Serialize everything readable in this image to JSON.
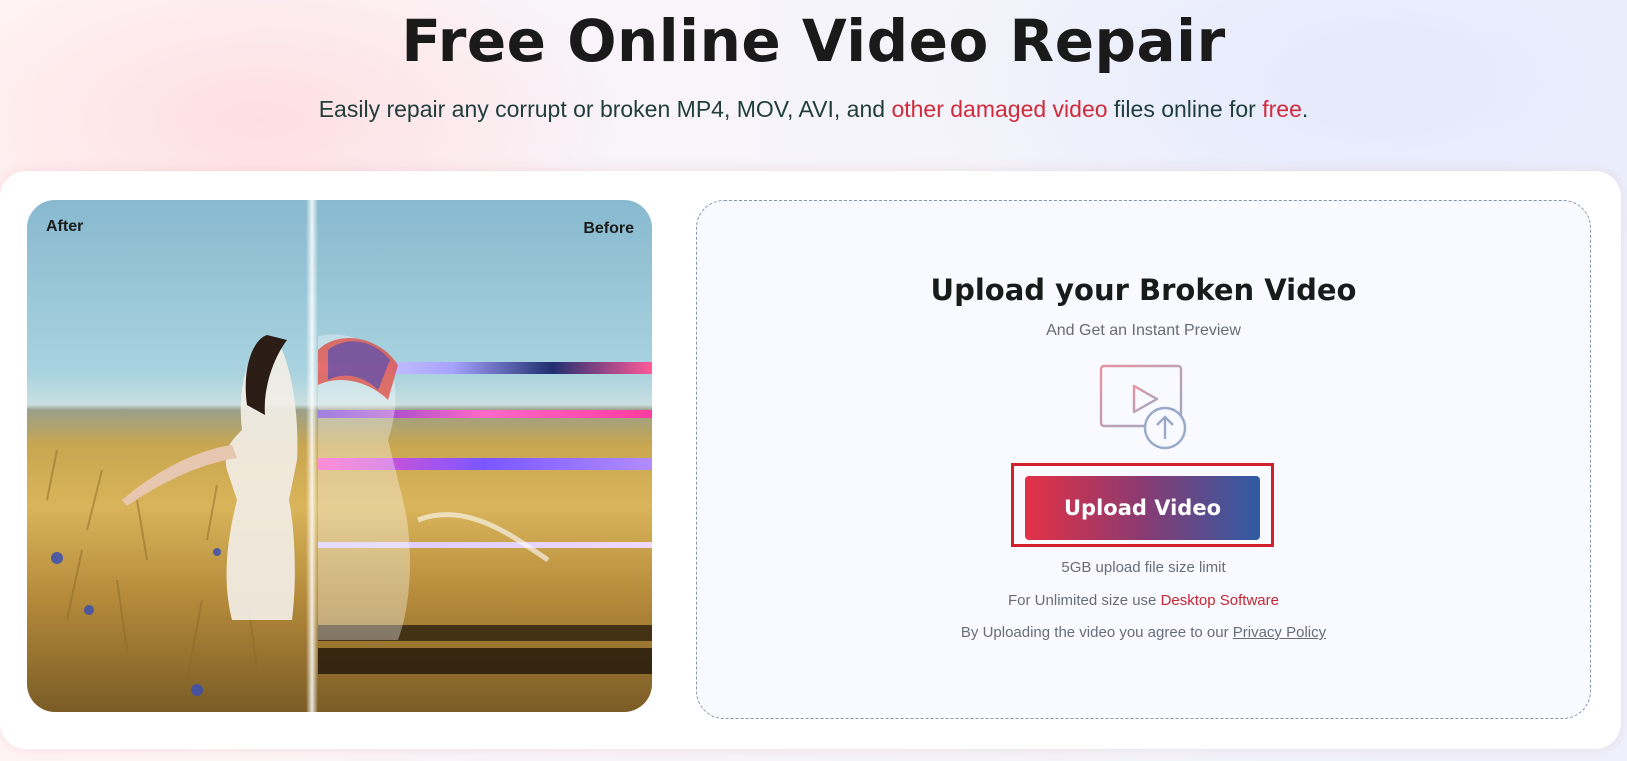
{
  "hero": {
    "title": "Free Online Video Repair",
    "subtitle_start": "Easily repair any corrupt or broken MP4, MOV, AVI, and ",
    "subtitle_highlight": "other damaged video",
    "subtitle_middle": " files online for ",
    "subtitle_free": "free",
    "subtitle_end": "."
  },
  "preview": {
    "after_label": "After",
    "before_label": "Before"
  },
  "upload": {
    "title": "Upload your Broken Video",
    "subtitle": "And Get an Instant Preview",
    "icon": "video-upload-icon",
    "button_label": "Upload Video",
    "size_limit": "5GB upload file size limit",
    "unlimited_prefix": "For Unlimited size use ",
    "desktop_link": "Desktop Software",
    "agree_prefix": "By Uploading the video you agree to our ",
    "privacy_link": "Privacy Policy"
  },
  "colors": {
    "accent_red": "#d12a3b",
    "button_gradient_start": "#e33145",
    "button_gradient_end": "#2f5ba4",
    "focus_outline": "#d11f2c"
  }
}
